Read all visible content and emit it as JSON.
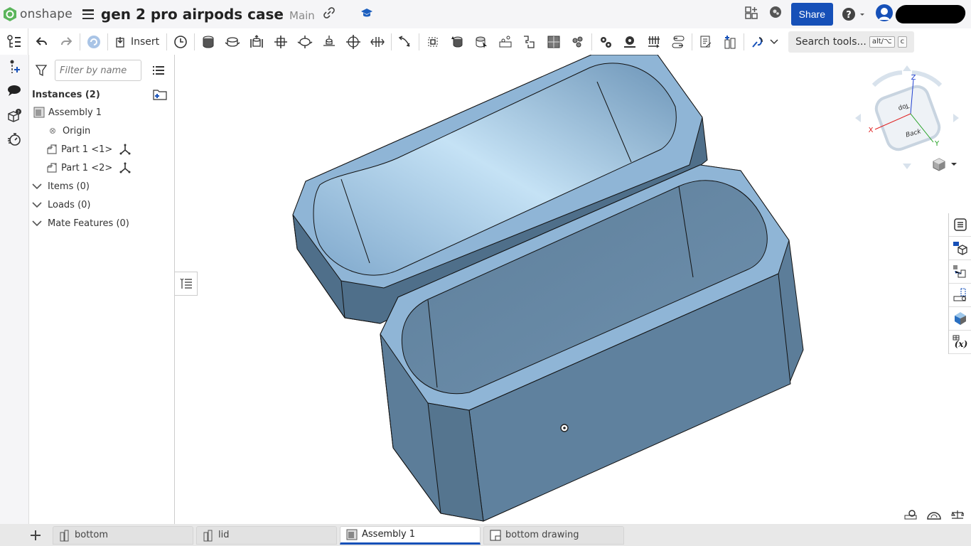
{
  "app": {
    "name": "onshape"
  },
  "document": {
    "title": "gen 2 pro airpods case",
    "branch": "Main"
  },
  "topbar": {
    "share_label": "Share",
    "help_icon": "help-icon",
    "user_icon": "user-avatar-icon"
  },
  "toolbar": {
    "insert_label": "Insert",
    "search_label": "Search tools...",
    "search_shortcut_1": "alt/⌥",
    "search_shortcut_2": "c",
    "icons": [
      "undo-icon",
      "redo-icon",
      "regenerate-icon",
      "insert-icon",
      "history-icon",
      "fastened-mate-icon",
      "revolute-mate-icon",
      "slider-mate-icon",
      "planar-mate-icon",
      "cylindrical-mate-icon",
      "pin-slot-mate-icon",
      "ball-mate-icon",
      "parallel-mate-icon",
      "tangent-mate-icon",
      "mate-connector-icon",
      "group-icon",
      "replicate-icon",
      "linear-pattern-icon",
      "circular-pattern-icon",
      "mirror-icon",
      "explode-icon",
      "gear-relation-icon",
      "rack-pinion-icon",
      "screw-relation-icon",
      "linear-relation-icon",
      "display-states-icon",
      "named-positions-icon",
      "animate-icon"
    ]
  },
  "panel": {
    "filter_placeholder": "Filter by name",
    "instances_header": "Instances (2)",
    "tree": [
      {
        "label": "Assembly 1",
        "type": "assembly"
      },
      {
        "label": "Origin",
        "type": "origin"
      },
      {
        "label": "Part 1 <1>",
        "type": "part"
      },
      {
        "label": "Part 1 <2>",
        "type": "part"
      }
    ],
    "sections": [
      {
        "label": "Items (0)"
      },
      {
        "label": "Loads (0)"
      },
      {
        "label": "Mate Features (0)"
      }
    ]
  },
  "view_cube": {
    "top_face": "Top",
    "back_face": "Back",
    "axis_x": "X",
    "axis_y": "Y",
    "axis_z": "Z",
    "colors": {
      "x": "#e02020",
      "y": "#20a020",
      "z": "#2040d0"
    }
  },
  "model": {
    "color": "#8fb5d6",
    "dark_color": "#4f6f8a"
  },
  "tabs": [
    {
      "label": "bottom",
      "type": "part-studio",
      "active": false
    },
    {
      "label": "lid",
      "type": "part-studio",
      "active": false
    },
    {
      "label": "Assembly 1",
      "type": "assembly",
      "active": true
    },
    {
      "label": "bottom drawing",
      "type": "drawing",
      "active": false
    }
  ],
  "colors": {
    "accent": "#1650b8"
  }
}
